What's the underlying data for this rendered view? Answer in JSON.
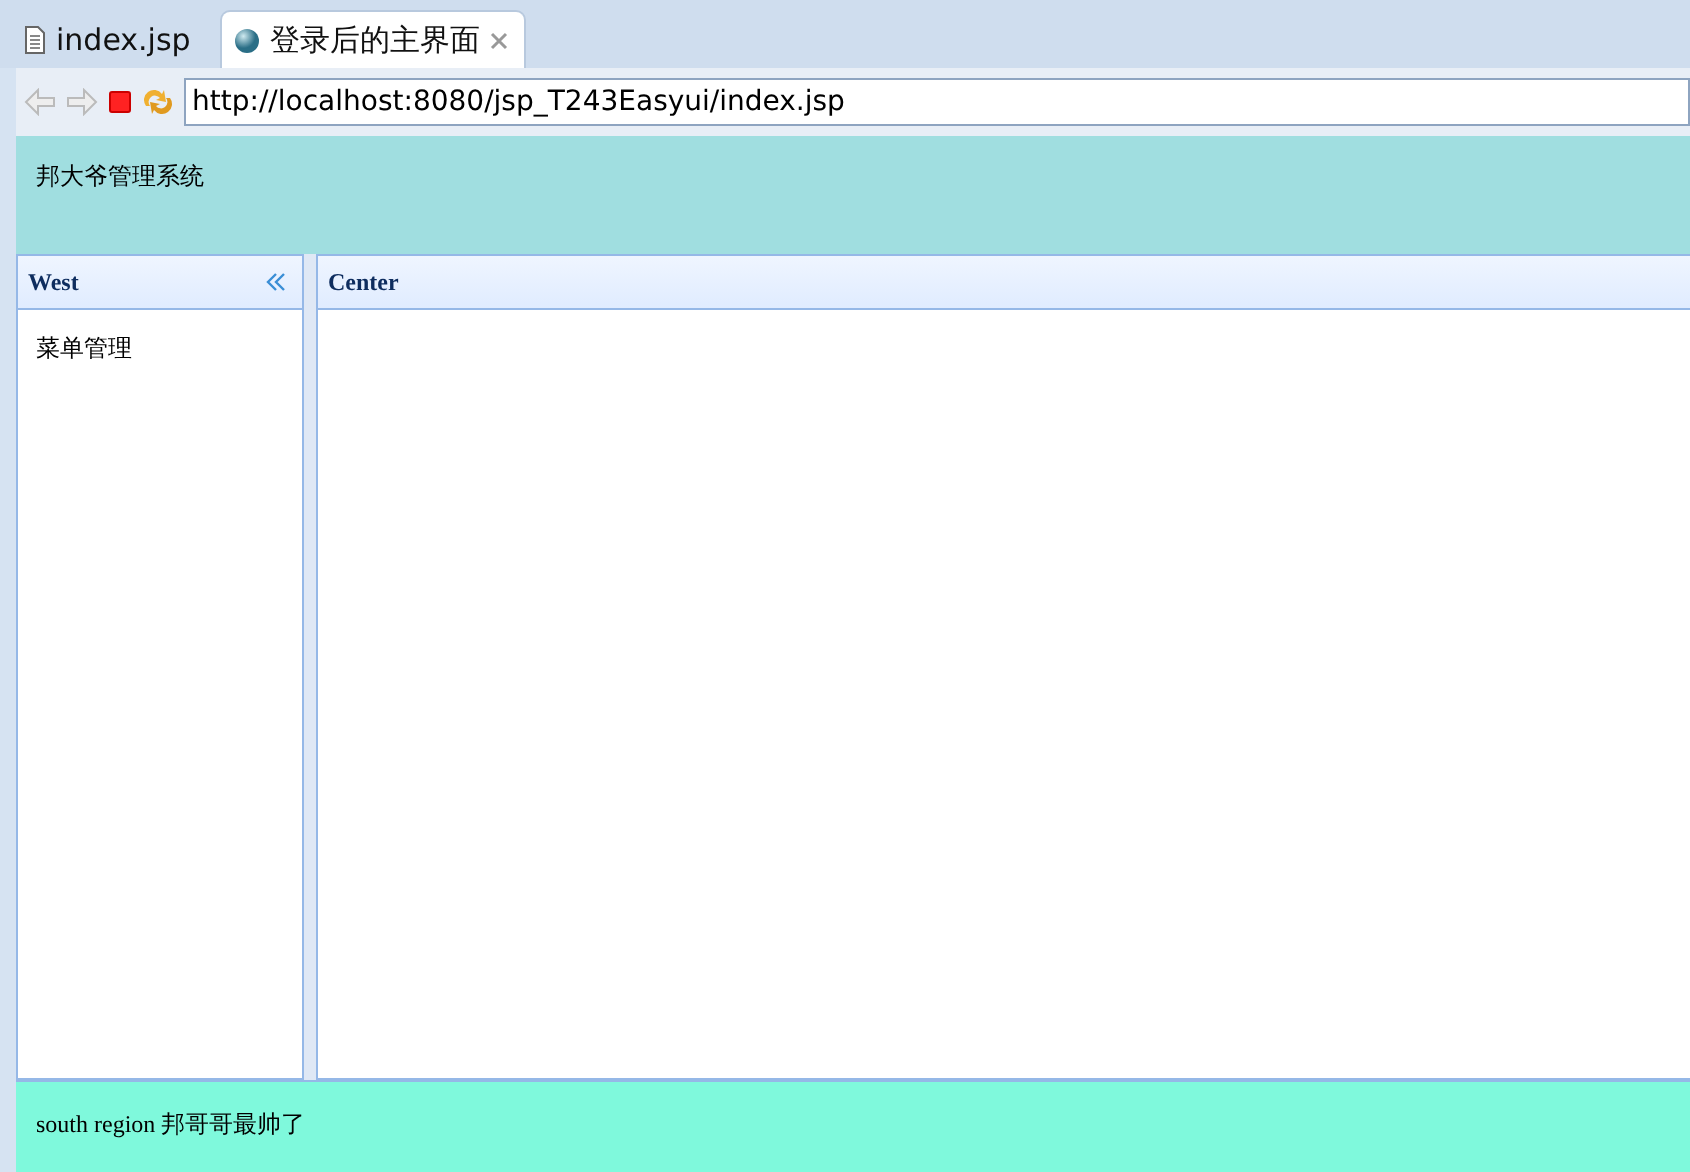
{
  "tabs": [
    {
      "label": "index.jsp",
      "kind": "file",
      "selected": false
    },
    {
      "label": "登录后的主界面",
      "kind": "web",
      "selected": true
    }
  ],
  "address_bar": {
    "value": "http://localhost:8080/jsp_T243Easyui/index.jsp"
  },
  "north": {
    "text": "邦大爷管理系统"
  },
  "west": {
    "title": "West",
    "items": [
      "菜单管理"
    ]
  },
  "center": {
    "title": "Center"
  },
  "south": {
    "text": "south region 邦哥哥最帅了"
  }
}
